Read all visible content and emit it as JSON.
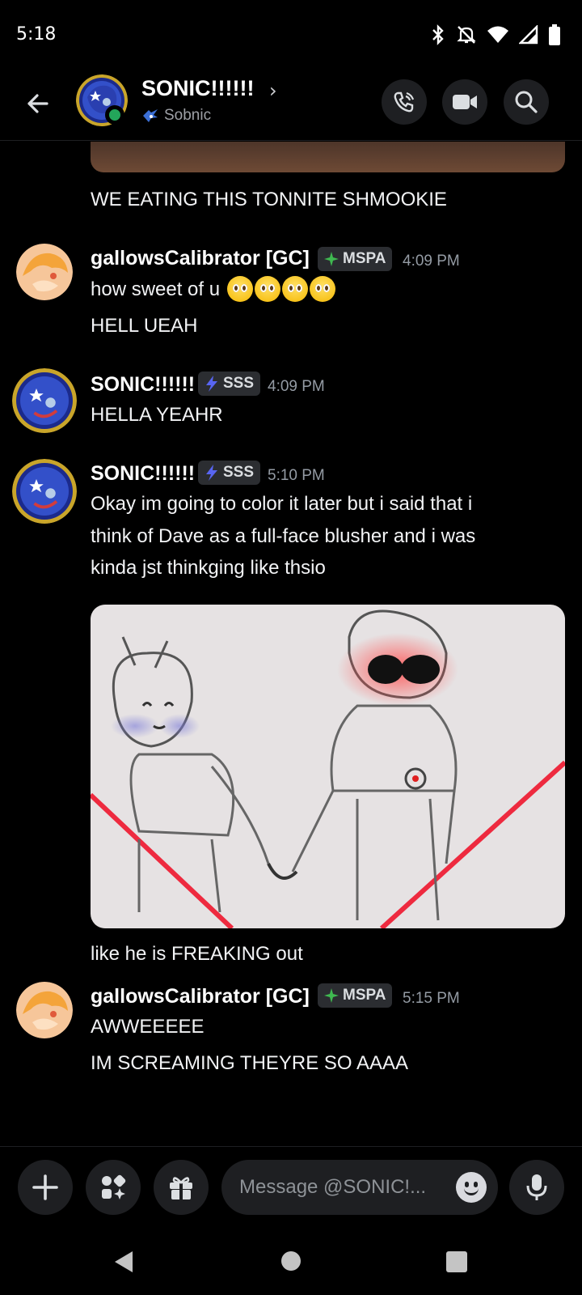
{
  "status_bar": {
    "time": "5:18"
  },
  "header": {
    "title": "SONIC!!!!!!",
    "subtitle": "Sobnic",
    "chevron": "›"
  },
  "messages": {
    "m0_text": "WE EATING THIS TONNITE SHMOOKIE",
    "m1": {
      "author": "gallowsCalibrator [GC]",
      "tag": "MSPA",
      "time": "4:09 PM",
      "line1": "how sweet of u",
      "line2": "HELL UEAH"
    },
    "m2": {
      "author": "SONIC!!!!!!",
      "tag": "SSS",
      "time": "4:09 PM",
      "line1": "HELLA YEAHR"
    },
    "m3": {
      "author": "SONIC!!!!!!",
      "tag": "SSS",
      "time": "5:10 PM",
      "line1": "Okay im going to color it later but i said that i",
      "line2": "think of Dave as a full-face blusher and i was",
      "line3": "kinda jst thinkging like thsio",
      "caption": "like he is FREAKING out"
    },
    "m4": {
      "author": "gallowsCalibrator [GC]",
      "tag": "MSPA",
      "time": "5:15 PM",
      "line1": "AWWEEEEE",
      "line2": "IM SCREAMING THEYRE SO AAAA"
    }
  },
  "composer": {
    "placeholder": "Message @SONIC!..."
  },
  "icons": {
    "status": [
      "bluetooth-icon",
      "silent-icon",
      "wifi-icon",
      "signal-icon",
      "battery-icon"
    ],
    "header": [
      "back-icon",
      "call-icon",
      "video-icon",
      "search-icon"
    ],
    "composer": [
      "plus-icon",
      "apps-icon",
      "gift-icon",
      "emoji-icon",
      "mic-icon"
    ]
  },
  "colors": {
    "background": "#000000",
    "online": "#23a55a",
    "tag_bg": "#2b2d31",
    "muted": "#949ba4"
  }
}
